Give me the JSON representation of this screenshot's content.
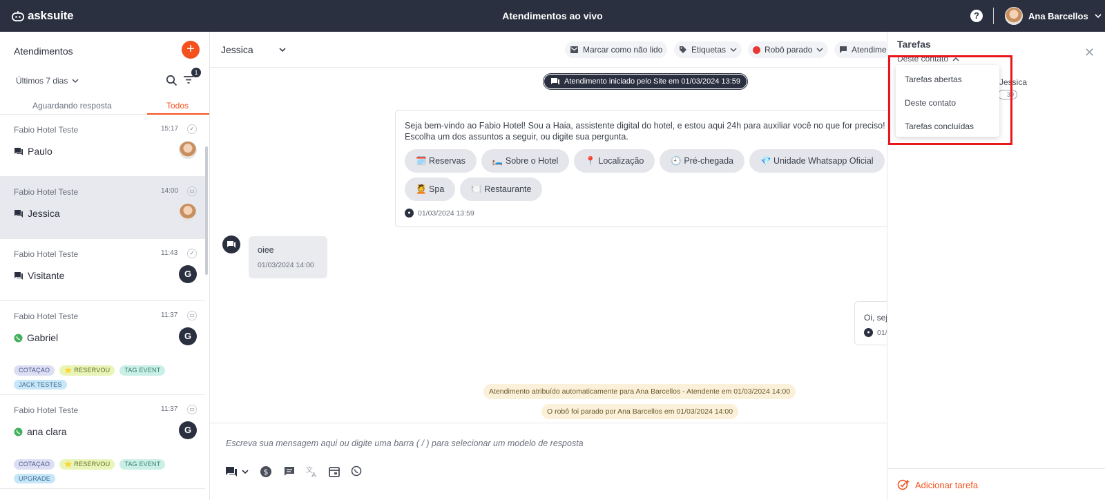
{
  "app": {
    "logo": "asksuite",
    "title": "Atendimentos ao vivo",
    "user": "Ana Barcellos",
    "help": "?"
  },
  "sidebar": {
    "title": "Atendimentos",
    "add": "+",
    "range": "Últimos 7 dias",
    "filter_count": "1",
    "tabs": [
      "Aguardando resposta",
      "Todos"
    ],
    "conversations": [
      {
        "hotel": "Fabio Hotel Teste",
        "time": "15:17",
        "name": "Paulo",
        "status": "✓",
        "channel": "chat",
        "avatar": "photo",
        "tags": []
      },
      {
        "hotel": "Fabio Hotel Teste",
        "time": "14:00",
        "name": "Jessica",
        "status": "▭",
        "channel": "chat",
        "avatar": "photo",
        "tags": []
      },
      {
        "hotel": "Fabio Hotel Teste",
        "time": "11:43",
        "name": "Visitante",
        "status": "✓",
        "channel": "chat",
        "avatar": "G",
        "tags": []
      },
      {
        "hotel": "Fabio Hotel Teste",
        "time": "11:37",
        "name": "Gabriel",
        "status": "▭",
        "channel": "whatsapp",
        "avatar": "G",
        "tags": [
          "COTAÇAO",
          "⭐ RESERVOU",
          "TAG EVENT",
          "JACK TESTES"
        ]
      },
      {
        "hotel": "Fabio Hotel Teste",
        "time": "11:37",
        "name": "ana clara",
        "status": "▭",
        "channel": "whatsapp",
        "avatar": "G",
        "tags": [
          "COTAÇAO",
          "⭐ RESERVOU",
          "TAG EVENT",
          "UPGRADE"
        ]
      }
    ]
  },
  "chat": {
    "contact": "Jessica",
    "actions": {
      "mark_unread": "Marcar como não lido",
      "tags": "Etiquetas",
      "robot": "Robô parado",
      "attend": "Atendime"
    },
    "start_notice": "Atendimento iniciado pelo Site em 01/03/2024 13:59",
    "bot_message": {
      "line1": "Seja bem-vindo ao Fabio Hotel! Sou a Haia, assistente digital do hotel, e estou aqui 24h para auxiliar você no que for preciso! 😊",
      "line2": "Escolha um dos assuntos a seguir, ou digite sua pergunta.",
      "options": [
        "🗓️ Reservas",
        "🛏️ Sobre o Hotel",
        "📍 Localização",
        "🕘 Pré-chegada",
        "💎 Unidade Whatsapp Oficial",
        "💆 Spa",
        "🍽️ Restaurante"
      ],
      "timestamp": "01/03/2024 13:59"
    },
    "user_message": {
      "text": "oiee",
      "timestamp": "01/03/2024 14:00"
    },
    "agent_message": {
      "text": "Oi, sej",
      "timestamp": "01/"
    },
    "system_messages": [
      "Atendimento atribuído automaticamente para Ana Barcellos - Atendente em 01/03/2024 14:00",
      "O robô foi parado por Ana Barcellos em 01/03/2024 14:00"
    ],
    "composer_placeholder": "Escreva sua mensagem aqui ou digite uma barra ( / ) para selecionar um modelo de resposta"
  },
  "tasks": {
    "title": "Tarefas",
    "filter": "Deste contato",
    "dropdown": [
      "Tarefas abertas",
      "Deste contato",
      "Tarefas concluídas"
    ],
    "behind_text": "Jessica",
    "behind_pill": "30",
    "add_label": "Adicionar tarefa"
  },
  "colors": {
    "topbar": "#2b3040",
    "accent": "#f4511e",
    "highlight": "#e8161c"
  }
}
